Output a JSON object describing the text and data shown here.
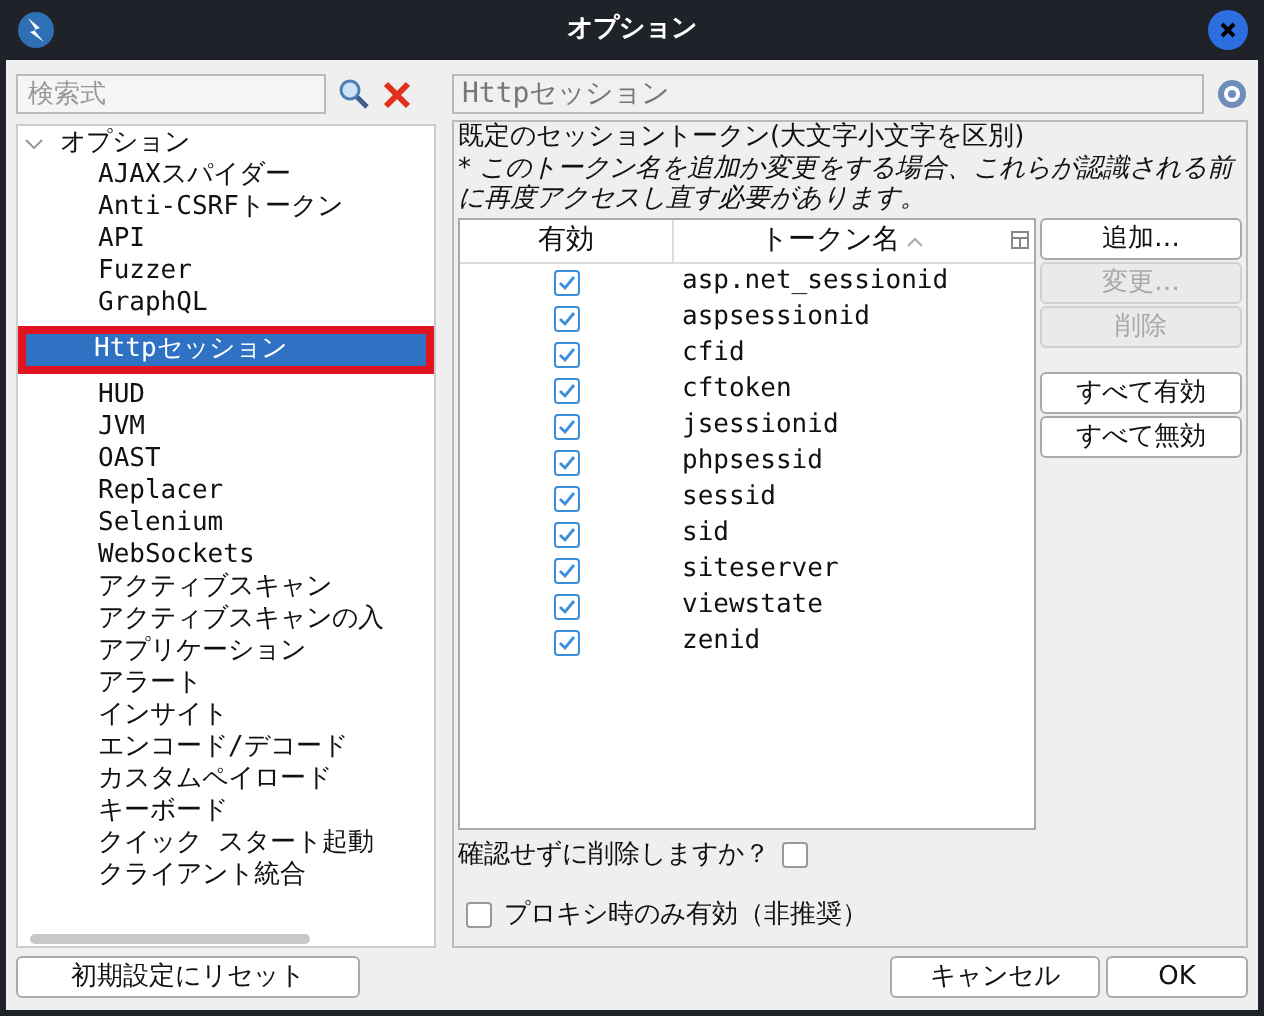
{
  "window": {
    "title": "オプション"
  },
  "search": {
    "placeholder": "検索式"
  },
  "tree": {
    "label": "オプション",
    "expanded": true,
    "children": [
      {
        "label": "AJAXスパイダー",
        "selected": false
      },
      {
        "label": "Anti-CSRFトークン",
        "selected": false
      },
      {
        "label": "API",
        "selected": false
      },
      {
        "label": "Fuzzer",
        "selected": false
      },
      {
        "label": "GraphQL",
        "selected": false
      },
      {
        "label": "Httpセッション",
        "selected": true
      },
      {
        "label": "HUD",
        "selected": false
      },
      {
        "label": "JVM",
        "selected": false
      },
      {
        "label": "OAST",
        "selected": false
      },
      {
        "label": "Replacer",
        "selected": false
      },
      {
        "label": "Selenium",
        "selected": false
      },
      {
        "label": "WebSockets",
        "selected": false
      },
      {
        "label": "アクティブスキャン",
        "selected": false
      },
      {
        "label": "アクティブスキャンの入",
        "selected": false
      },
      {
        "label": "アプリケーション",
        "selected": false
      },
      {
        "label": "アラート",
        "selected": false
      },
      {
        "label": "インサイト",
        "selected": false
      },
      {
        "label": "エンコード/デコード",
        "selected": false
      },
      {
        "label": "カスタムペイロード",
        "selected": false
      },
      {
        "label": "キーボード",
        "selected": false
      },
      {
        "label": "クイック スタート起動",
        "selected": false
      },
      {
        "label": "クライアント統合",
        "selected": false
      }
    ]
  },
  "panel_title": "Httpセッション",
  "heading": "既定のセッショントークン(大文字小文字を区別)",
  "note": "* このトークン名を追加か変更をする場合、これらが認識される前に再度アクセスし直す必要があります。",
  "table": {
    "columns": [
      {
        "label": "有効",
        "sorted": false
      },
      {
        "label": "トークン名",
        "sorted": true
      }
    ],
    "rows": [
      {
        "enabled": true,
        "name": "asp.net_sessionid"
      },
      {
        "enabled": true,
        "name": "aspsessionid"
      },
      {
        "enabled": true,
        "name": "cfid"
      },
      {
        "enabled": true,
        "name": "cftoken"
      },
      {
        "enabled": true,
        "name": "jsessionid"
      },
      {
        "enabled": true,
        "name": "phpsessid"
      },
      {
        "enabled": true,
        "name": "sessid"
      },
      {
        "enabled": true,
        "name": "sid"
      },
      {
        "enabled": true,
        "name": "siteserver"
      },
      {
        "enabled": true,
        "name": "viewstate"
      },
      {
        "enabled": true,
        "name": "zenid"
      }
    ]
  },
  "edit_buttons": [
    {
      "label": "追加…",
      "disabled": false
    },
    {
      "label": "変更…",
      "disabled": true
    },
    {
      "label": "削除",
      "disabled": true
    }
  ],
  "toggle_buttons": [
    {
      "label": "すべて有効",
      "disabled": false
    },
    {
      "label": "すべて無効",
      "disabled": false
    }
  ],
  "confirm_delete": {
    "label": "確認せずに削除しますか？",
    "checked": false
  },
  "proxy_only": {
    "label": "プロキシ時のみ有効（非推奨）",
    "checked": false
  },
  "reset_button": "初期設定にリセット",
  "footer_buttons": [
    "キャンセル",
    "OK"
  ]
}
